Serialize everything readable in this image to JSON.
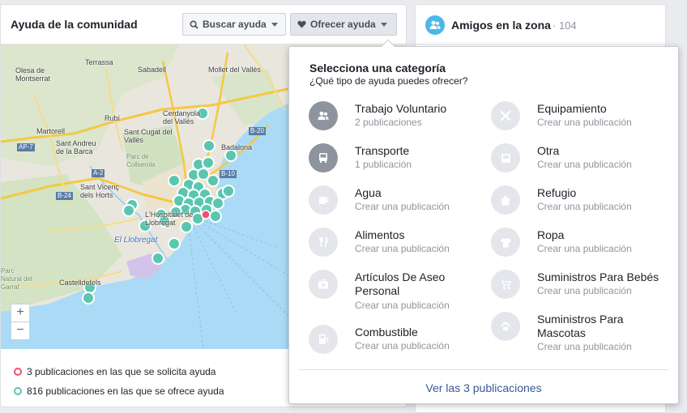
{
  "community": {
    "title": "Ayuda de la comunidad",
    "search_button": "Buscar ayuda",
    "offer_button": "Ofrecer ayuda"
  },
  "map": {
    "zoom_in": "+",
    "zoom_out": "−",
    "labels": {
      "terrassa": "Terrassa",
      "sabadell": "Sabadell",
      "mollet": "Mollet del Vallès",
      "olesa": "Olesa de Montserrat",
      "rubi": "Rubí",
      "cerdanyola": "Cerdanyola del Vallès",
      "martorell": "Martorell",
      "santcugat": "Sant Cugat del Vallès",
      "badalona": "Badalona",
      "santandreu": "Sant Andreu de la Barca",
      "parc": "Parc de Collserola",
      "santvicenc": "Sant Vicenç dels Horts",
      "hospitalet": "L'Hospitalet de Llobregat",
      "llobregat": "El Llobregat",
      "garraf": "Parc Natural del Garraf",
      "castelldefels": "Castelldefels",
      "ap7": "AP-7",
      "a2": "A-2",
      "b24": "B-24",
      "b20": "B-20",
      "b10": "B-10"
    }
  },
  "legend": {
    "ask": "3 publicaciones en las que se solicita ayuda",
    "offer": "816 publicaciones en las que se ofrece ayuda"
  },
  "friends": {
    "title": "Amigos en la zona",
    "count": "· 104"
  },
  "dropdown": {
    "title": "Selecciona una categoría",
    "subtitle": "¿Qué tipo de ayuda puedes ofrecer?",
    "categories": [
      {
        "name": "Trabajo Voluntario",
        "sub": "2 publicaciones",
        "icon": "volunteer-icon"
      },
      {
        "name": "Equipamiento",
        "sub": "Crear una publicación",
        "icon": "tools-icon"
      },
      {
        "name": "Transporte",
        "sub": "1 publicación",
        "icon": "bus-icon"
      },
      {
        "name": "Otra",
        "sub": "Crear una publicación",
        "icon": "inbox-icon"
      },
      {
        "name": "Agua",
        "sub": "Crear una publicación",
        "icon": "cup-icon"
      },
      {
        "name": "Refugio",
        "sub": "Crear una publicación",
        "icon": "home-icon"
      },
      {
        "name": "Alimentos",
        "sub": "Crear una publicación",
        "icon": "cutlery-icon"
      },
      {
        "name": "Ropa",
        "sub": "Crear una publicación",
        "icon": "shirt-icon"
      },
      {
        "name": "Artículos De Aseo Personal",
        "sub": "Crear una publicación",
        "icon": "first-aid-icon"
      },
      {
        "name": "Suministros Para Bebés",
        "sub": "Crear una publicación",
        "icon": "stroller-icon"
      },
      {
        "name": "Combustible",
        "sub": "Crear una publicación",
        "icon": "fuel-icon"
      },
      {
        "name": "Suministros Para Mascotas",
        "sub": "Crear una publicación",
        "icon": "paw-icon"
      }
    ],
    "footer": "Ver las 3 publicaciones"
  },
  "colors": {
    "offer_marker": "#5bc6b0",
    "ask_marker": "#f0506e",
    "link": "#385898",
    "friends_accent": "#4db7e8"
  }
}
